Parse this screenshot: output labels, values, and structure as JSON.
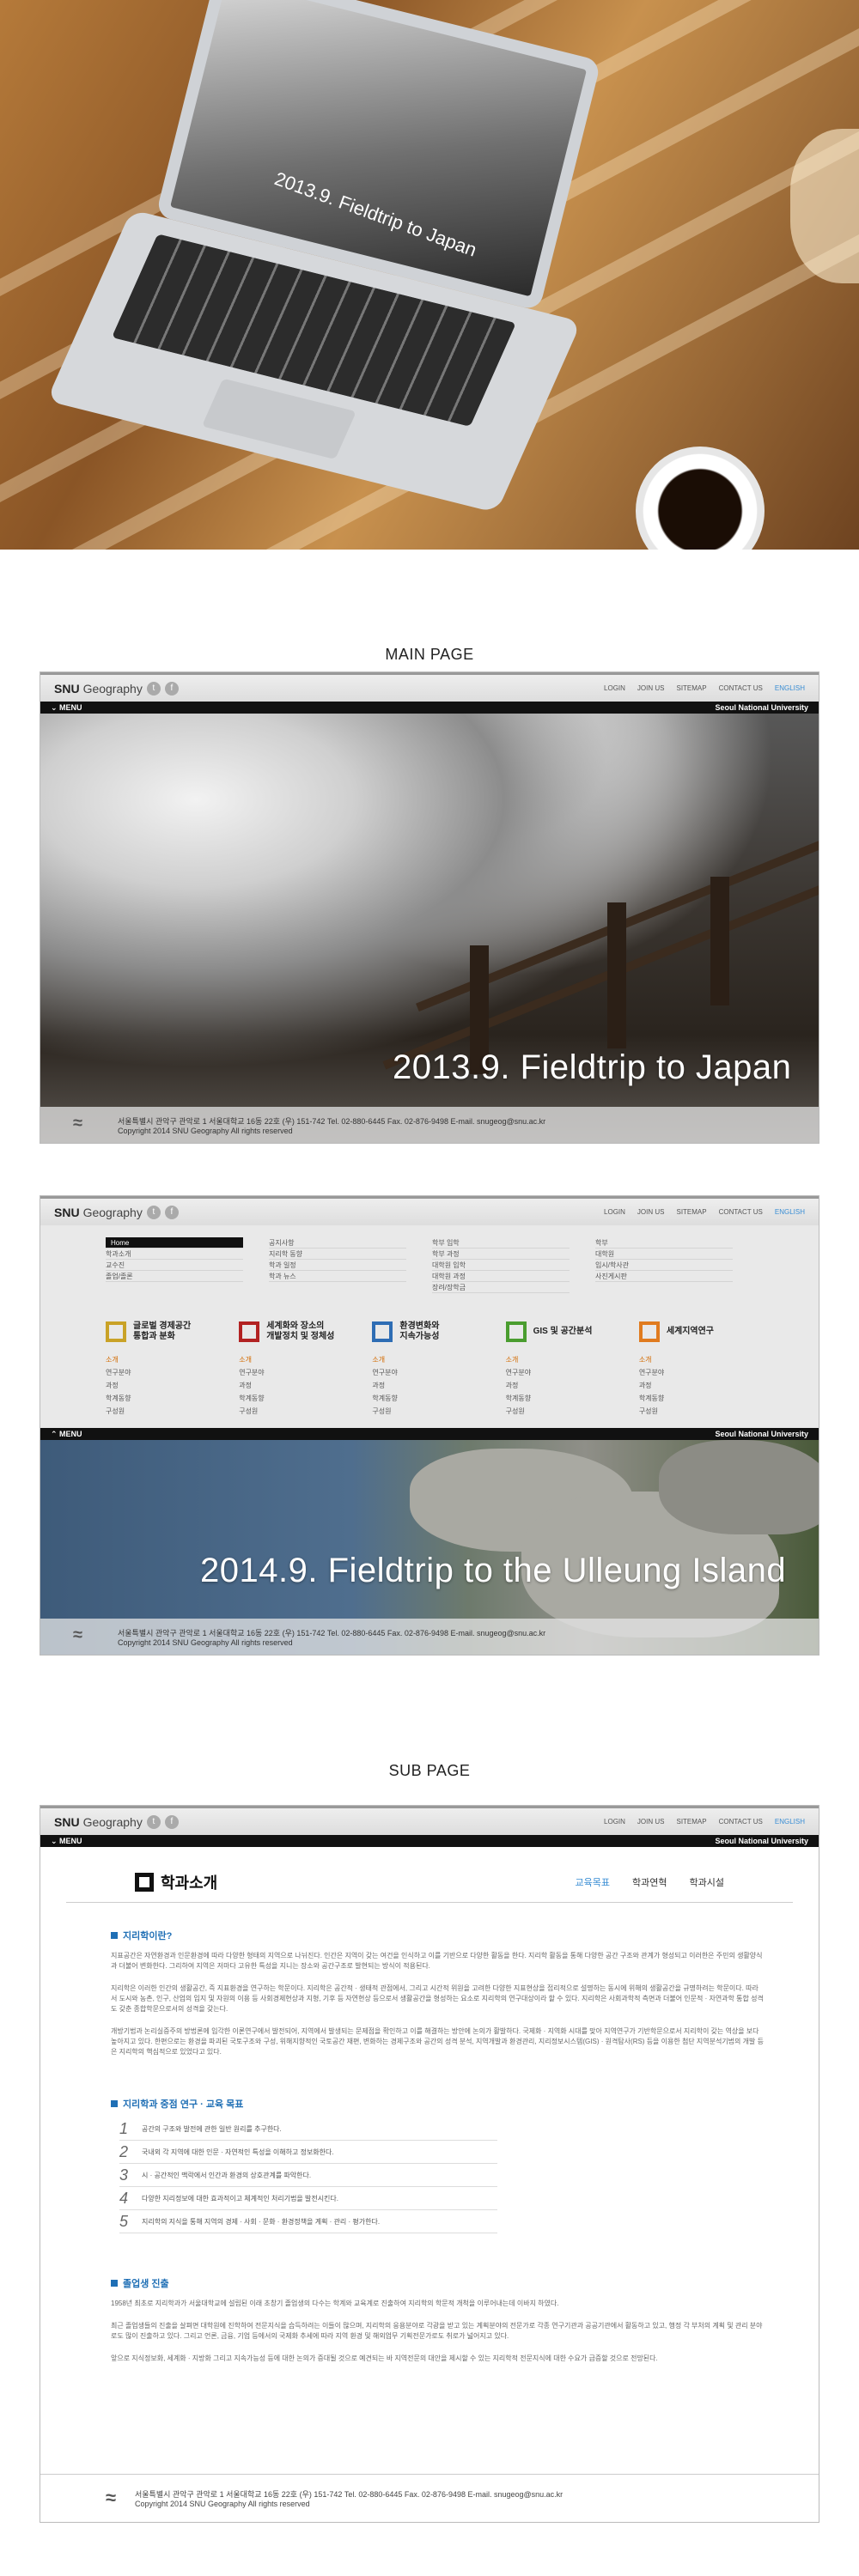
{
  "hero": {
    "screen_caption": "2013.9. Fieldtrip to Japan"
  },
  "labels": {
    "main": "MAIN PAGE",
    "sub": "SUB PAGE"
  },
  "header": {
    "logo": "SNU",
    "logo_word": "Geography",
    "nav": [
      "LOGIN",
      "JOIN US",
      "SITEMAP",
      "CONTACT US",
      "ENGLISH"
    ],
    "menu": "MENU",
    "university": "Seoul National University"
  },
  "banner1": {
    "title": "2013.9. Fieldtrip to Japan"
  },
  "banner2": {
    "title": "2014.9. Fieldtrip to  the Ulleung  Island"
  },
  "footer": {
    "address": "서울특별시 관악구 관악로 1 서울대학교 16동 22호 (우) 151-742   Tel. 02-880-6445   Fax. 02-876-9498   E-mail. snugeog@snu.ac.kr",
    "copyright": "Copyright 2014 SNU Geography All rights reserved"
  },
  "megamenu": {
    "columns": [
      [
        "Home",
        "학과소개",
        "교수진",
        "졸업/졸론"
      ],
      [
        "공지사항",
        "지리학 동향",
        "학과 일정",
        "학과 뉴스"
      ],
      [
        "학부 입학",
        "학부 과정",
        "대학원 입학",
        "대학원 과정",
        "장려/장학금"
      ],
      [
        "학부",
        "대학원",
        "입시/학사관",
        "사진게시판"
      ]
    ],
    "cards": [
      {
        "title": "글로벌 경제공간\n통합과 분화",
        "color": "#c9a227",
        "items": [
          "소개",
          "연구분야",
          "과정",
          "학계동향",
          "구성원"
        ]
      },
      {
        "title": "세계화와 장소의\n개발정치 및 정체성",
        "color": "#b22222",
        "items": [
          "소개",
          "연구분야",
          "과정",
          "학계동향",
          "구성원"
        ]
      },
      {
        "title": "환경변화와\n지속가능성",
        "color": "#2e6db4",
        "items": [
          "소개",
          "연구분야",
          "과정",
          "학계동향",
          "구성원"
        ]
      },
      {
        "title": "GIS 및 공간분석",
        "color": "#4a9d2f",
        "items": [
          "소개",
          "연구분야",
          "과정",
          "학계동향",
          "구성원"
        ]
      },
      {
        "title": "세계지역연구",
        "color": "#e07b1f",
        "items": [
          "소개",
          "연구분야",
          "과정",
          "학계동향",
          "구성원"
        ]
      }
    ]
  },
  "subpage": {
    "title": "학과소개",
    "tabs": [
      "교육목표",
      "학과연혁",
      "학과시설"
    ],
    "s1": {
      "title": "지리학이란?",
      "p1": "지표공간은 자연환경과 인문환경에 따라 다양한 형태의 지역으로 나뉘진다. 인간은 지역이 갖는 여건을 인식하고 이를 기반으로 다양한 활동을 한다. 지리학 활동을 통해 다양한 공간 구조와 관계가 형성되고 이러한은 주민의 생활양식과 더불어 변화한다. 그리하여 지역은 저마다 고유한 특성을 지니는 장소와 공간구조로 발현되는 방식이 적용된다.",
      "p2": "지리학은 이러한 인간의 생활공간, 즉 지표환경을 연구하는 학문이다. 지리학은 공간적 · 생태적 관점에서, 그리고 시간적 위원을 고려한 다양한 지표현상을 접리적으로 설명하는 동시에 위해의 생활공간을 규명하려는 학문이다. 따라서 도시와 농촌, 인구, 산업의 입지 및 자원의 이용 등 사회경제현상과 지형, 기후 등 자연현상 등으로서 생활공간을 형성하는 요소로 지리학의 연구대상이라 할 수 있다. 지리학은 사회과학적 측면과 더불어 인문적 · 자연과학 통합 성격도 갖춘 종합학문으로서의 성격을 갖는다.",
      "p3": "개방기법과 논리실증주의 방법론에 입각한 이론연구에서 발전되어, 지역에서 발생되는 문제점을 확인하고 이를 해결하는 방안에 논의가 활발하다. 국제화 · 지역화 시대를 맞아 지역연구가 기반학문으로서 지리학이 갖는 역상을 보다 높아지고 있다. 한편으로는 환경을 파괴된 국토구조와 구성, 위해지향적인 국토공간 재편, 변화하는 경제구조와 공간의 성격 분석, 지역개발과 환경관리, 지리정보시스템(GIS) · 원격탐사(RS) 등을 이용한 첨단 지역분석기법의 개발 등은 지리학의 핵심적으로 있었다고 있다."
    },
    "s2": {
      "title": "지리학과 중점 연구 · 교육 목표",
      "goals": [
        {
          "n": "1",
          "t": "공간의 구조와 발전에 관한 일반 원리를 추구한다."
        },
        {
          "n": "2",
          "t": "국내외 각 지역에 대한 인문 · 자연적인 특성을 이해하고 정보화한다."
        },
        {
          "n": "3",
          "t": "시 · 공간적인 맥락에서 인간과 환경의 상호관계를 파악한다."
        },
        {
          "n": "4",
          "t": "다양한 지리정보에 대한 효과적이고 체계적인 처리기법을 발전시킨다."
        },
        {
          "n": "5",
          "t": "지리학의 지식을 통해 지역의 경제 · 사회 · 문화 · 환경정책을 계획 · 관리 · 평가한다."
        }
      ]
    },
    "s3": {
      "title": "졸업생 진출",
      "p1": "1958년 최초로 지리학과가 서울대학교에 설립된 이래 초창기 졸업생의 다수는 학계와 교육계로 진출하여 지리학의 학문적 개척을 이루어내는데 이바지 하였다.",
      "p2": "최근 졸업생들의 진출을 살펴면 대학원에 진학하여 전문지식을 습득하려는 이들이 많으며, 지리학의 응용분야로 각광을 받고 있는 계획분야의 전문가로 각종 연구기관과 공공기관에서 활동하고 있고, 행정 각 부처의 계획 및 관리 분야로도 많이 진출하고 있다. 그리고 언론, 금융, 기업 등에서의 국제화 추세에 따라 지역 환경 및 해외업무 기획전문가로도 취로가 넓어지고 있다.",
      "p3": "앞으로 지식정보화, 세계화 · 지방화 그리고 지속가능성 등에 대한 논의가 증대될 것으로 예견되는 바 지역전문의 대안을 제시할 수 있는 지리학적 전문지식에 대한 수요가 급증할 것으로 전망된다."
    }
  }
}
